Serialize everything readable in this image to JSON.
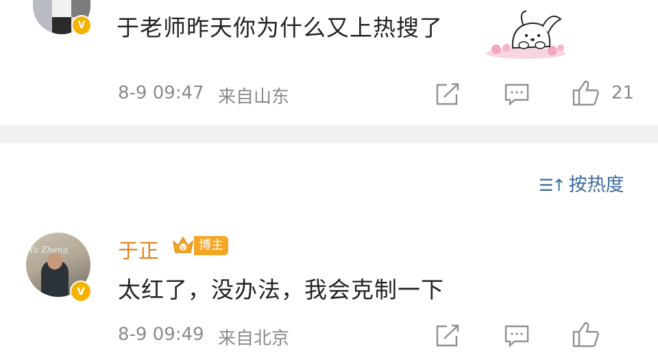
{
  "post1": {
    "text": "于老师昨天你为什么又上热搜了",
    "time": "8-9 09:47",
    "location": "来自山东",
    "likes": "21",
    "avatar_badge": "V"
  },
  "sort_label": "按热度",
  "post2": {
    "username": "于正",
    "role_badge": "博主",
    "text": "太红了，没办法，我会克制一下",
    "time": "8-9 09:49",
    "location": "来自北京",
    "avatar_badge": "V",
    "avatar_sign_text": "Yu Zheng"
  },
  "colors": {
    "username": "#e8821e",
    "badge_orange": "#f5a623",
    "link_blue": "#3d6a9e",
    "meta_gray": "#8a8a8a",
    "divider": "#f1f1f1"
  }
}
